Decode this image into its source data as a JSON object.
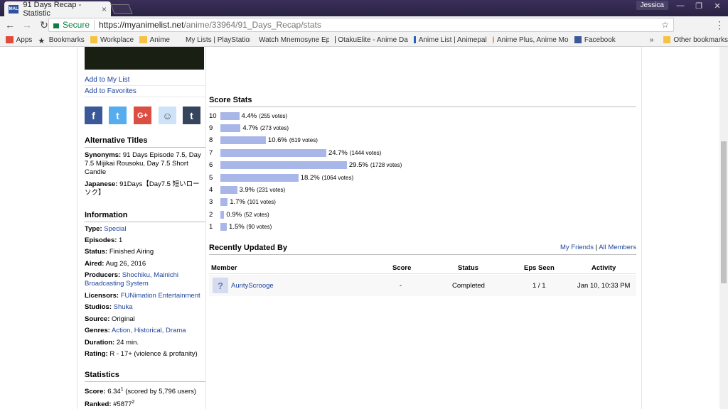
{
  "browser": {
    "tab_title": "91 Days Recap - Statistic",
    "tab_favicon": "MAL",
    "user_label": "Jessica",
    "secure_label": "Secure",
    "url_host": "https://myanimelist.net",
    "url_path": "/anime/33964/91_Days_Recap/stats",
    "bookmarks": [
      {
        "label": "Apps",
        "icon": "apps-icon"
      },
      {
        "label": "Bookmarks",
        "icon": "star-icon"
      },
      {
        "label": "Workplace",
        "icon": "folder-icon"
      },
      {
        "label": "Anime",
        "icon": "folder-icon"
      },
      {
        "label": "My Lists | PlayStation®",
        "icon": "page-icon"
      },
      {
        "label": "Watch Mnemosyne Ep",
        "icon": "page-icon"
      },
      {
        "label": "OtakuElite - Anime Da",
        "icon": "page-icon"
      },
      {
        "label": "Anime List | Animepal",
        "icon": "page-icon"
      },
      {
        "label": "Anime Plus, Anime Mo",
        "icon": "page-icon"
      },
      {
        "label": "Facebook",
        "icon": "facebook-icon"
      }
    ],
    "bookmarks_more": "»",
    "other_bookmarks": "Other bookmarks"
  },
  "sidebar": {
    "add_to_list": "Add to My List",
    "add_to_favorites": "Add to Favorites",
    "alt_titles_heading": "Alternative Titles",
    "synonyms_label": "Synonyms:",
    "synonyms_value": "91 Days Episode 7.5, Day 7.5 Mijikai Rousoku, Day 7.5 Short Candle",
    "japanese_label": "Japanese:",
    "japanese_value": "91Days【Day7.5 短いローソク】",
    "information_heading": "Information",
    "info": [
      {
        "label": "Type:",
        "value": "Special",
        "link": true
      },
      {
        "label": "Episodes:",
        "value": "1",
        "link": false
      },
      {
        "label": "Status:",
        "value": "Finished Airing",
        "link": false
      },
      {
        "label": "Aired:",
        "value": "Aug 26, 2016",
        "link": false
      },
      {
        "label": "Producers:",
        "value": "Shochiku, Mainichi Broadcasting System",
        "link": true
      },
      {
        "label": "Licensors:",
        "value": "FUNimation Entertainment",
        "link": true
      },
      {
        "label": "Studios:",
        "value": "Shuka",
        "link": true
      },
      {
        "label": "Source:",
        "value": "Original",
        "link": false
      },
      {
        "label": "Genres:",
        "value": "Action, Historical, Drama",
        "link": true
      },
      {
        "label": "Duration:",
        "value": "24 min.",
        "link": false
      },
      {
        "label": "Rating:",
        "value": "R - 17+ (violence & profanity)",
        "link": false
      }
    ],
    "statistics_heading": "Statistics",
    "score_label": "Score:",
    "score_value": "6.34",
    "score_sup": "1",
    "score_note": "(scored by 5,796 users)",
    "ranked_label": "Ranked:",
    "ranked_value": "#5877",
    "ranked_sup": "2"
  },
  "score_stats": {
    "heading": "Score Stats",
    "rows": [
      {
        "score": "10",
        "pct": "4.4%",
        "votes": "(255 votes)",
        "value": 4.4
      },
      {
        "score": "9",
        "pct": "4.7%",
        "votes": "(273 votes)",
        "value": 4.7
      },
      {
        "score": "8",
        "pct": "10.6%",
        "votes": "(619 votes)",
        "value": 10.6
      },
      {
        "score": "7",
        "pct": "24.7%",
        "votes": "(1444 votes)",
        "value": 24.7
      },
      {
        "score": "6",
        "pct": "29.5%",
        "votes": "(1728 votes)",
        "value": 29.5
      },
      {
        "score": "5",
        "pct": "18.2%",
        "votes": "(1064 votes)",
        "value": 18.2
      },
      {
        "score": "4",
        "pct": "3.9%",
        "votes": "(231 votes)",
        "value": 3.9
      },
      {
        "score": "3",
        "pct": "1.7%",
        "votes": "(101 votes)",
        "value": 1.7
      },
      {
        "score": "2",
        "pct": "0.9%",
        "votes": "(52 votes)",
        "value": 0.9
      },
      {
        "score": "1",
        "pct": "1.5%",
        "votes": "(90 votes)",
        "value": 1.5
      }
    ]
  },
  "recent": {
    "heading": "Recently Updated By",
    "my_friends": "My Friends",
    "divider": "|",
    "all_members": "All Members",
    "columns": [
      "Member",
      "Score",
      "Status",
      "Eps Seen",
      "Activity"
    ],
    "rows": [
      {
        "member": "AuntyScrooge",
        "score": "-",
        "status": "Completed",
        "eps": "1 / 1",
        "activity": "Jan 10, 10:33 PM"
      }
    ]
  },
  "colors": {
    "bar": "#a9b7e8",
    "link": "#1d439b"
  }
}
